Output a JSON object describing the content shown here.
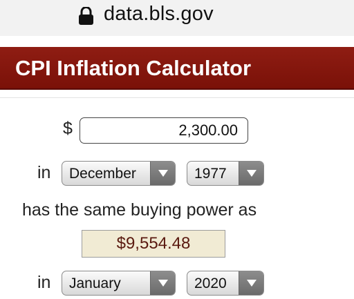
{
  "browser": {
    "url": "data.bls.gov"
  },
  "header": {
    "title": "CPI Inflation Calculator"
  },
  "form": {
    "currency_symbol": "$",
    "amount_value": "2,300.00",
    "in_label_1": "in",
    "from_month": "December",
    "from_year": "1977",
    "sentence": "has the same buying power as",
    "result": "$9,554.48",
    "in_label_2": "in",
    "to_month": "January",
    "to_year": "2020"
  },
  "colors": {
    "banner": "#8a1a10",
    "result_bg": "#f1ebd4",
    "result_text": "#5a1a10"
  }
}
